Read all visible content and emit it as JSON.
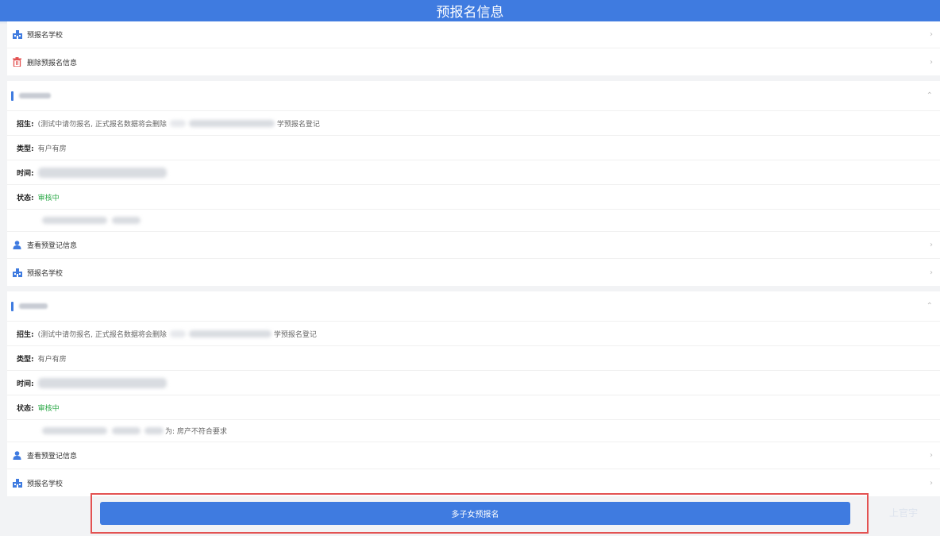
{
  "header": {
    "title": "预报名信息"
  },
  "top_actions": [
    {
      "label": "预报名学校",
      "icon": "school-icon"
    },
    {
      "label": "删除预报名信息",
      "icon": "trash-icon"
    }
  ],
  "sections": [
    {
      "fields": {
        "enroll_label": "招生:",
        "enroll_prefix": "(测试中请勿报名, 正式报名数据将会删除",
        "enroll_suffix": "学预报名登记",
        "type_label": "类型:",
        "type_value": "有户有房",
        "time_label": "时间:",
        "status_label": "状态:",
        "status_value": "审核中",
        "note_suffix": ""
      },
      "actions": [
        {
          "label": "查看预登记信息",
          "icon": "person-icon"
        },
        {
          "label": "预报名学校",
          "icon": "school-icon"
        }
      ]
    },
    {
      "fields": {
        "enroll_label": "招生:",
        "enroll_prefix": "(测试中请勿报名, 正式报名数据将会删除",
        "enroll_suffix": "学预报名登记",
        "type_label": "类型:",
        "type_value": "有户有房",
        "time_label": "时间:",
        "status_label": "状态:",
        "status_value": "审核中",
        "note_suffix": "为: 房产不符合要求"
      },
      "actions": [
        {
          "label": "查看预登记信息",
          "icon": "person-icon"
        },
        {
          "label": "预报名学校",
          "icon": "school-icon"
        }
      ]
    }
  ],
  "bottom_button": {
    "label": "多子女预报名"
  },
  "watermark": "上官宇",
  "colors": {
    "primary": "#3f7be0",
    "success": "#2aa846",
    "danger": "#e35252"
  }
}
